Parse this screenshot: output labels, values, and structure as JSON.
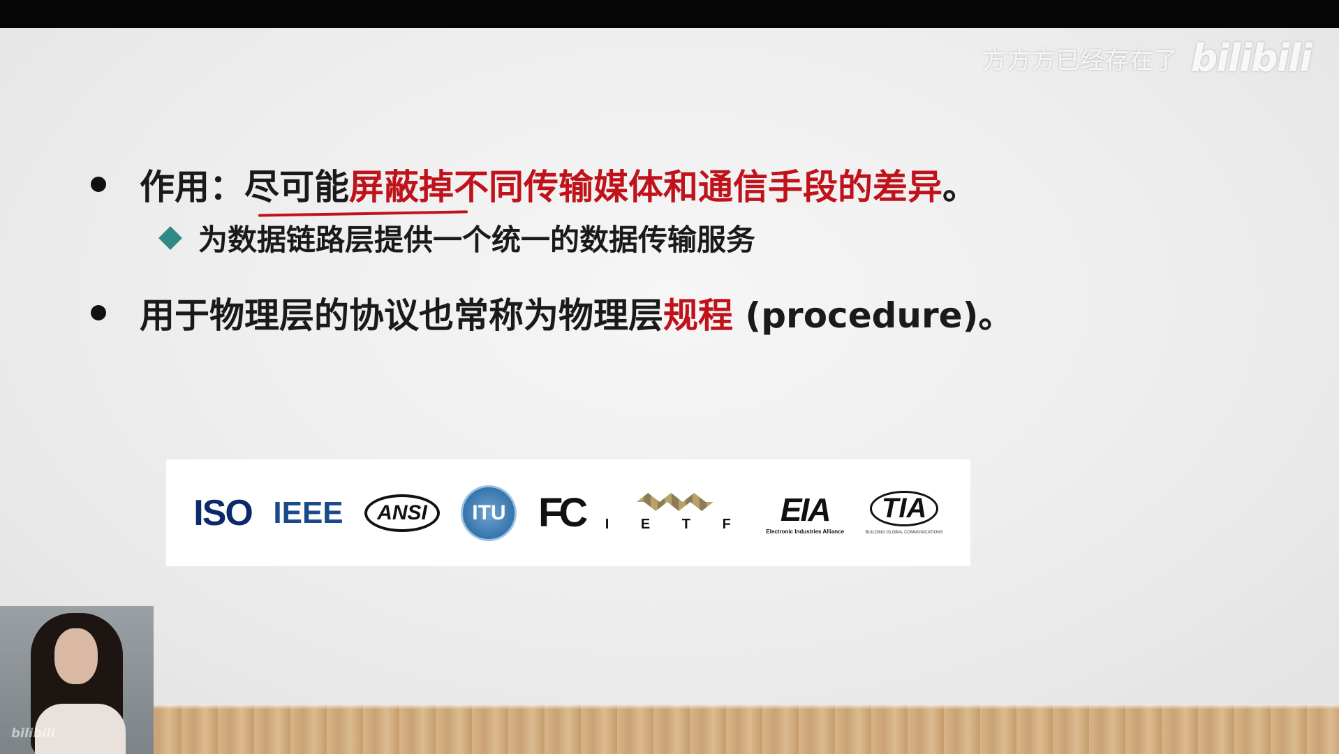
{
  "watermark": {
    "user": "方方方已经存在了",
    "logo": "bilibili"
  },
  "slide": {
    "bullet1": {
      "prefix": "作用：尽可能",
      "highlight": "屏蔽掉不同传输媒体和通信手段的差异",
      "suffix": "。"
    },
    "sub_bullet": "为数据链路层提供一个统一的数据传输服务",
    "bullet2": {
      "prefix": "用于物理层的协议也常称为物理层",
      "highlight": "规程",
      "suffix": " (procedure)。"
    },
    "logos": {
      "iso": "ISO",
      "ieee": "IEEE",
      "ansi": "ANSI",
      "itu": "ITU",
      "fcc": "FC",
      "ietf": "I E T F",
      "eia": "EIA",
      "eia_sub": "Electronic Industries Alliance",
      "tia": "TIA",
      "tia_sub": "BUILDING GLOBAL COMMUNICATIONS"
    }
  },
  "colors": {
    "highlight": "#c0121a",
    "diamond": "#2f8a86"
  },
  "icons": [
    "bullet-dot-icon",
    "diamond-bullet-icon"
  ],
  "video_watermark": "bilibili"
}
